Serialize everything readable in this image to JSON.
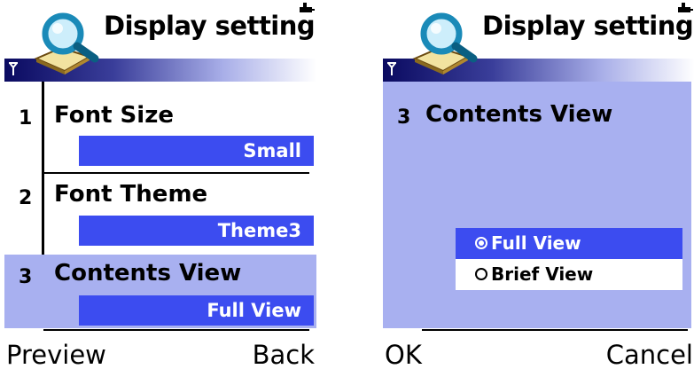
{
  "left_screen": {
    "title": "Display setting",
    "items": [
      {
        "num": "1",
        "label": "Font Size",
        "value": "Small"
      },
      {
        "num": "2",
        "label": "Font Theme",
        "value": "Theme3"
      },
      {
        "num": "3",
        "label": "Contents View",
        "value": "Full View"
      }
    ],
    "selected_item": 3,
    "softkeys": {
      "left": "Preview",
      "right": "Back"
    }
  },
  "right_screen": {
    "title": "Display setting",
    "item": {
      "num": "3",
      "label": "Contents View"
    },
    "options": [
      {
        "label": "Full View",
        "selected": true
      },
      {
        "label": "Brief View",
        "selected": false
      }
    ],
    "softkeys": {
      "left": "OK",
      "right": "Cancel"
    }
  },
  "colors": {
    "highlight": "#3c4cf0",
    "selection_bg": "#a8b0f0",
    "title_gradient_start": "#0a0a60"
  },
  "icons": {
    "title": "magnifier-book-icon",
    "signal": "signal-antenna-icon",
    "battery": "battery-icon"
  }
}
